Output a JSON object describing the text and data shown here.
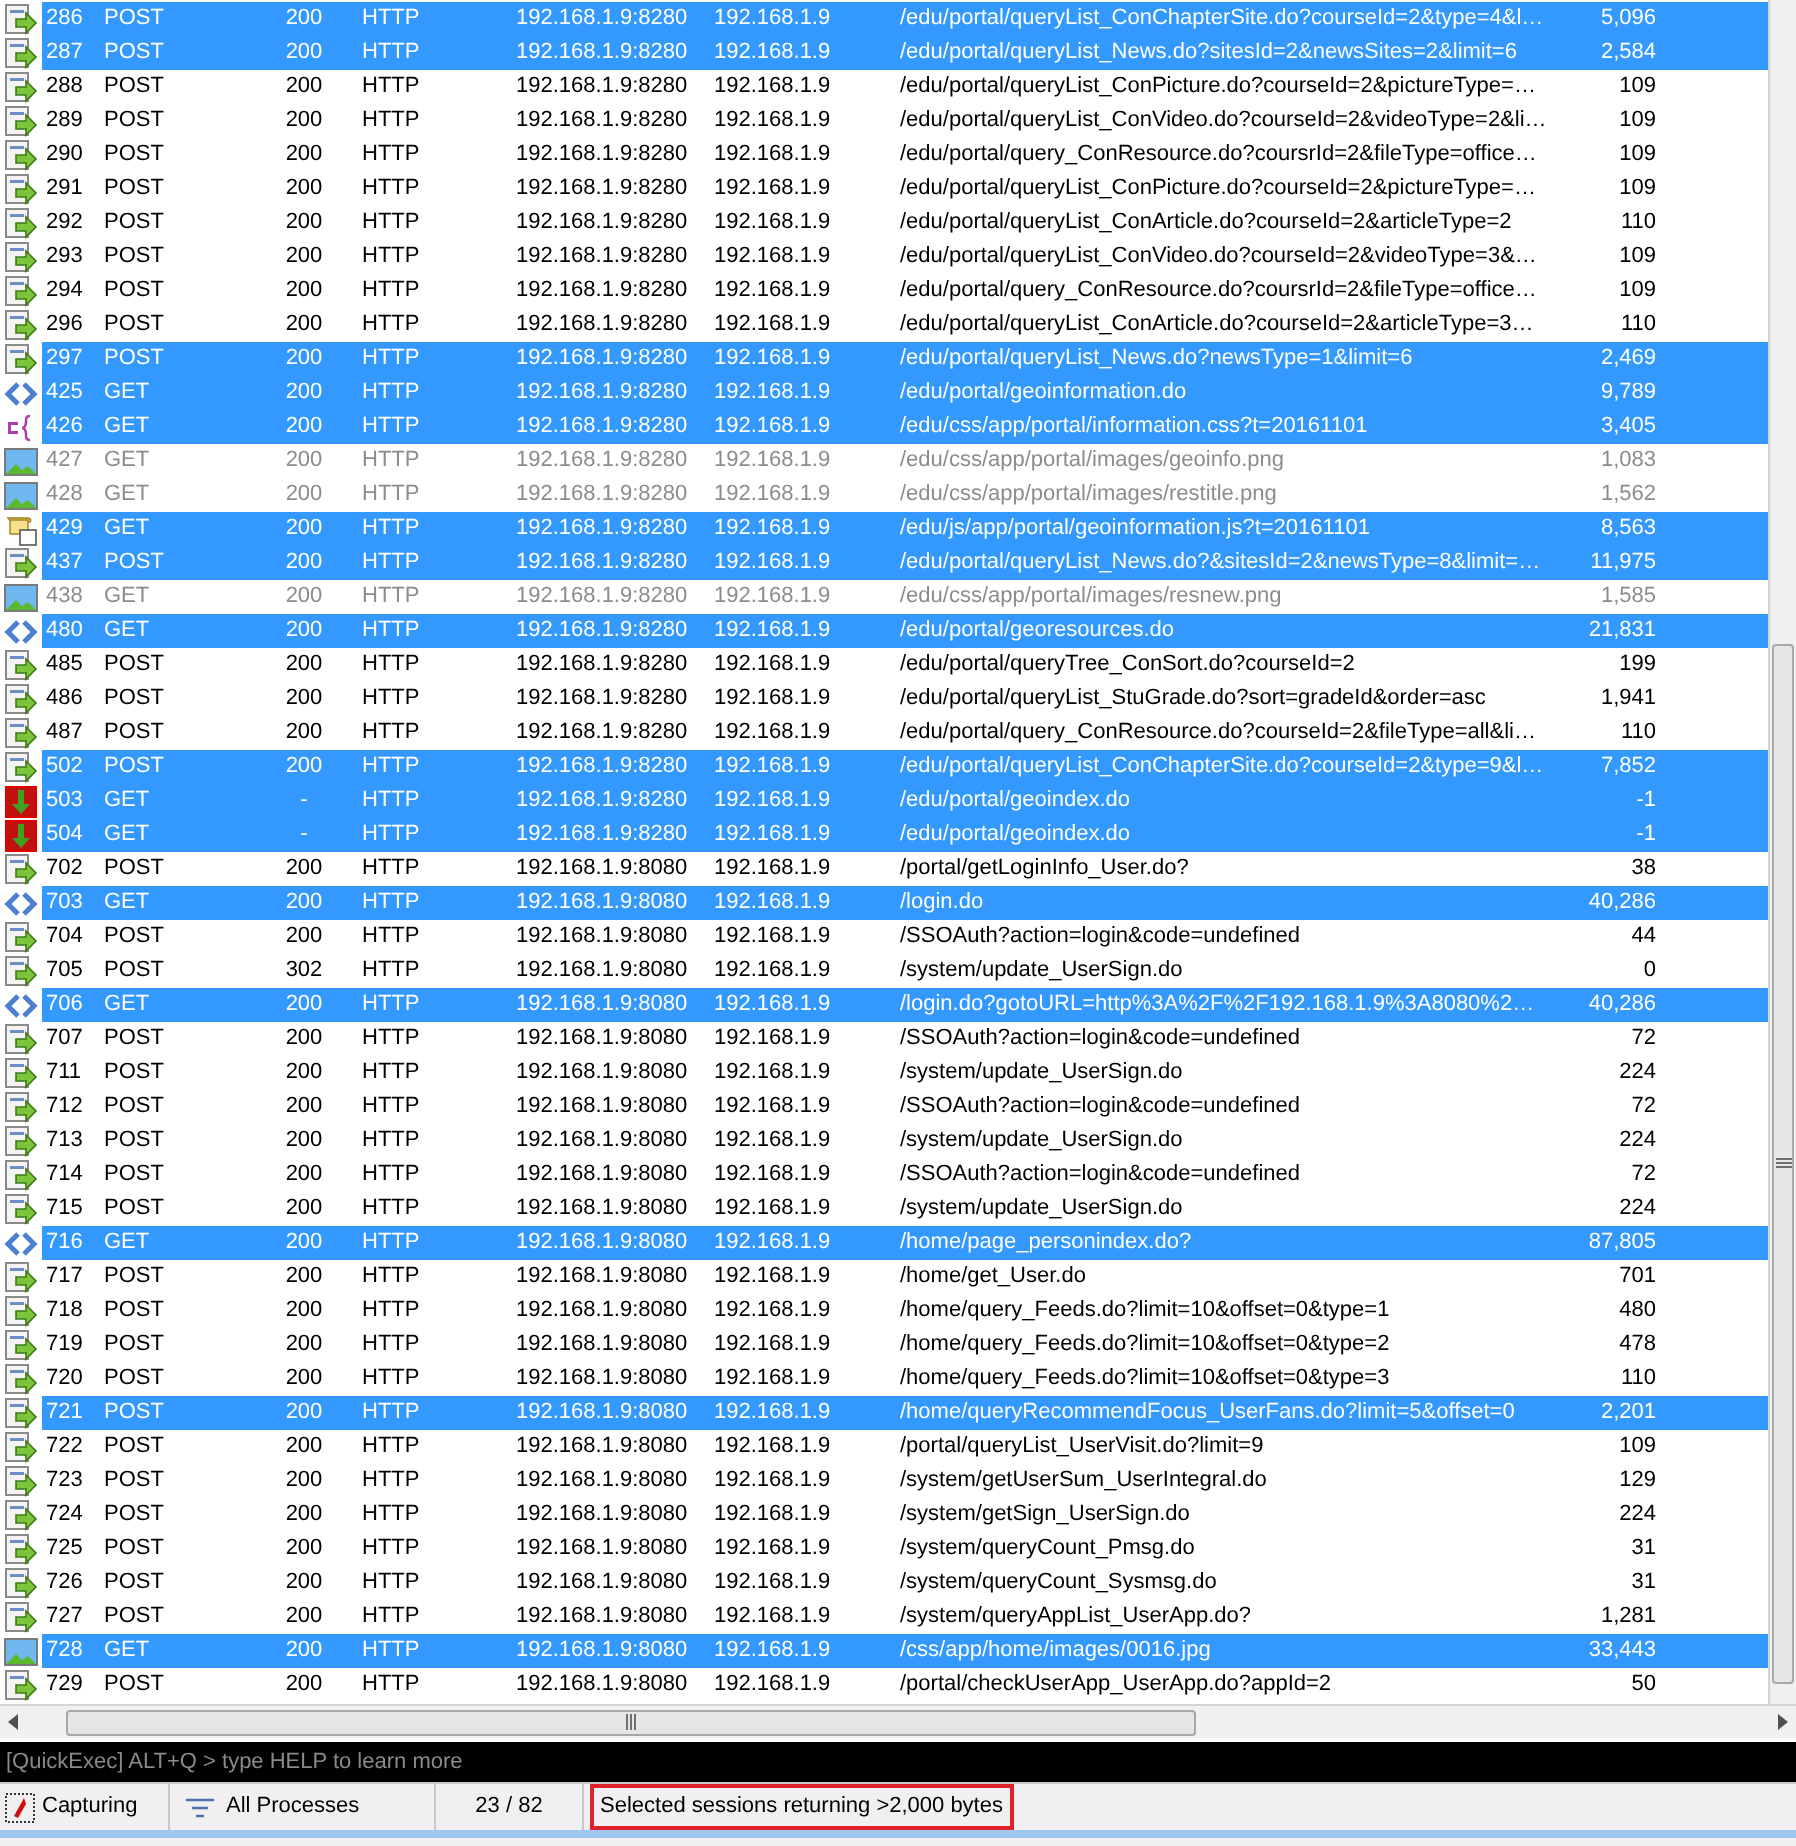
{
  "sessions": [
    {
      "kind": "post",
      "num": "286",
      "method": "POST",
      "result": "200",
      "protocol": "HTTP",
      "host": "192.168.1.9:8280",
      "server_ip": "192.168.1.9",
      "url": "/edu/portal/queryList_ConChapterSite.do?courseId=2&type=4&l…",
      "size": "5,096",
      "selected": true,
      "greyed": false
    },
    {
      "kind": "post",
      "num": "287",
      "method": "POST",
      "result": "200",
      "protocol": "HTTP",
      "host": "192.168.1.9:8280",
      "server_ip": "192.168.1.9",
      "url": "/edu/portal/queryList_News.do?sitesId=2&newsSites=2&limit=6",
      "size": "2,584",
      "selected": true,
      "greyed": false
    },
    {
      "kind": "post",
      "num": "288",
      "method": "POST",
      "result": "200",
      "protocol": "HTTP",
      "host": "192.168.1.9:8280",
      "server_ip": "192.168.1.9",
      "url": "/edu/portal/queryList_ConPicture.do?courseId=2&pictureType=…",
      "size": "109",
      "selected": false,
      "greyed": false
    },
    {
      "kind": "post",
      "num": "289",
      "method": "POST",
      "result": "200",
      "protocol": "HTTP",
      "host": "192.168.1.9:8280",
      "server_ip": "192.168.1.9",
      "url": "/edu/portal/queryList_ConVideo.do?courseId=2&videoType=2&li…",
      "size": "109",
      "selected": false,
      "greyed": false
    },
    {
      "kind": "post",
      "num": "290",
      "method": "POST",
      "result": "200",
      "protocol": "HTTP",
      "host": "192.168.1.9:8280",
      "server_ip": "192.168.1.9",
      "url": "/edu/portal/query_ConResource.do?coursrId=2&fileType=office…",
      "size": "109",
      "selected": false,
      "greyed": false
    },
    {
      "kind": "post",
      "num": "291",
      "method": "POST",
      "result": "200",
      "protocol": "HTTP",
      "host": "192.168.1.9:8280",
      "server_ip": "192.168.1.9",
      "url": "/edu/portal/queryList_ConPicture.do?courseId=2&pictureType=…",
      "size": "109",
      "selected": false,
      "greyed": false
    },
    {
      "kind": "post",
      "num": "292",
      "method": "POST",
      "result": "200",
      "protocol": "HTTP",
      "host": "192.168.1.9:8280",
      "server_ip": "192.168.1.9",
      "url": "/edu/portal/queryList_ConArticle.do?courseId=2&articleType=2",
      "size": "110",
      "selected": false,
      "greyed": false
    },
    {
      "kind": "post",
      "num": "293",
      "method": "POST",
      "result": "200",
      "protocol": "HTTP",
      "host": "192.168.1.9:8280",
      "server_ip": "192.168.1.9",
      "url": "/edu/portal/queryList_ConVideo.do?courseId=2&videoType=3&…",
      "size": "109",
      "selected": false,
      "greyed": false
    },
    {
      "kind": "post",
      "num": "294",
      "method": "POST",
      "result": "200",
      "protocol": "HTTP",
      "host": "192.168.1.9:8280",
      "server_ip": "192.168.1.9",
      "url": "/edu/portal/query_ConResource.do?coursrId=2&fileType=office…",
      "size": "109",
      "selected": false,
      "greyed": false
    },
    {
      "kind": "post",
      "num": "296",
      "method": "POST",
      "result": "200",
      "protocol": "HTTP",
      "host": "192.168.1.9:8280",
      "server_ip": "192.168.1.9",
      "url": "/edu/portal/queryList_ConArticle.do?courseId=2&articleType=3…",
      "size": "110",
      "selected": false,
      "greyed": false
    },
    {
      "kind": "post",
      "num": "297",
      "method": "POST",
      "result": "200",
      "protocol": "HTTP",
      "host": "192.168.1.9:8280",
      "server_ip": "192.168.1.9",
      "url": "/edu/portal/queryList_News.do?newsType=1&limit=6",
      "size": "2,469",
      "selected": true,
      "greyed": false
    },
    {
      "kind": "html",
      "num": "425",
      "method": "GET",
      "result": "200",
      "protocol": "HTTP",
      "host": "192.168.1.9:8280",
      "server_ip": "192.168.1.9",
      "url": "/edu/portal/geoinformation.do",
      "size": "9,789",
      "selected": true,
      "greyed": false
    },
    {
      "kind": "css",
      "num": "426",
      "method": "GET",
      "result": "200",
      "protocol": "HTTP",
      "host": "192.168.1.9:8280",
      "server_ip": "192.168.1.9",
      "url": "/edu/css/app/portal/information.css?t=20161101",
      "size": "3,405",
      "selected": true,
      "greyed": false
    },
    {
      "kind": "image",
      "num": "427",
      "method": "GET",
      "result": "200",
      "protocol": "HTTP",
      "host": "192.168.1.9:8280",
      "server_ip": "192.168.1.9",
      "url": "/edu/css/app/portal/images/geoinfo.png",
      "size": "1,083",
      "selected": false,
      "greyed": true
    },
    {
      "kind": "image",
      "num": "428",
      "method": "GET",
      "result": "200",
      "protocol": "HTTP",
      "host": "192.168.1.9:8280",
      "server_ip": "192.168.1.9",
      "url": "/edu/css/app/portal/images/restitle.png",
      "size": "1,562",
      "selected": false,
      "greyed": true
    },
    {
      "kind": "js",
      "num": "429",
      "method": "GET",
      "result": "200",
      "protocol": "HTTP",
      "host": "192.168.1.9:8280",
      "server_ip": "192.168.1.9",
      "url": "/edu/js/app/portal/geoinformation.js?t=20161101",
      "size": "8,563",
      "selected": true,
      "greyed": false
    },
    {
      "kind": "post",
      "num": "437",
      "method": "POST",
      "result": "200",
      "protocol": "HTTP",
      "host": "192.168.1.9:8280",
      "server_ip": "192.168.1.9",
      "url": "/edu/portal/queryList_News.do?&sitesId=2&newsType=8&limit=…",
      "size": "11,975",
      "selected": true,
      "greyed": false
    },
    {
      "kind": "image",
      "num": "438",
      "method": "GET",
      "result": "200",
      "protocol": "HTTP",
      "host": "192.168.1.9:8280",
      "server_ip": "192.168.1.9",
      "url": "/edu/css/app/portal/images/resnew.png",
      "size": "1,585",
      "selected": false,
      "greyed": true
    },
    {
      "kind": "html",
      "num": "480",
      "method": "GET",
      "result": "200",
      "protocol": "HTTP",
      "host": "192.168.1.9:8280",
      "server_ip": "192.168.1.9",
      "url": "/edu/portal/georesources.do",
      "size": "21,831",
      "selected": true,
      "greyed": false
    },
    {
      "kind": "post",
      "num": "485",
      "method": "POST",
      "result": "200",
      "protocol": "HTTP",
      "host": "192.168.1.9:8280",
      "server_ip": "192.168.1.9",
      "url": "/edu/portal/queryTree_ConSort.do?courseId=2",
      "size": "199",
      "selected": false,
      "greyed": false
    },
    {
      "kind": "post",
      "num": "486",
      "method": "POST",
      "result": "200",
      "protocol": "HTTP",
      "host": "192.168.1.9:8280",
      "server_ip": "192.168.1.9",
      "url": "/edu/portal/queryList_StuGrade.do?sort=gradeId&order=asc",
      "size": "1,941",
      "selected": false,
      "greyed": false
    },
    {
      "kind": "post",
      "num": "487",
      "method": "POST",
      "result": "200",
      "protocol": "HTTP",
      "host": "192.168.1.9:8280",
      "server_ip": "192.168.1.9",
      "url": "/edu/portal/query_ConResource.do?courseId=2&fileType=all&li…",
      "size": "110",
      "selected": false,
      "greyed": false
    },
    {
      "kind": "post",
      "num": "502",
      "method": "POST",
      "result": "200",
      "protocol": "HTTP",
      "host": "192.168.1.9:8280",
      "server_ip": "192.168.1.9",
      "url": "/edu/portal/queryList_ConChapterSite.do?courseId=2&type=9&l…",
      "size": "7,852",
      "selected": true,
      "greyed": false
    },
    {
      "kind": "error",
      "num": "503",
      "method": "GET",
      "result": "-",
      "protocol": "HTTP",
      "host": "192.168.1.9:8280",
      "server_ip": "192.168.1.9",
      "url": "/edu/portal/geoindex.do",
      "size": "-1",
      "selected": true,
      "greyed": false
    },
    {
      "kind": "error",
      "num": "504",
      "method": "GET",
      "result": "-",
      "protocol": "HTTP",
      "host": "192.168.1.9:8280",
      "server_ip": "192.168.1.9",
      "url": "/edu/portal/geoindex.do",
      "size": "-1",
      "selected": true,
      "greyed": false
    },
    {
      "kind": "post",
      "num": "702",
      "method": "POST",
      "result": "200",
      "protocol": "HTTP",
      "host": "192.168.1.9:8080",
      "server_ip": "192.168.1.9",
      "url": "/portal/getLoginInfo_User.do?",
      "size": "38",
      "selected": false,
      "greyed": false
    },
    {
      "kind": "html",
      "num": "703",
      "method": "GET",
      "result": "200",
      "protocol": "HTTP",
      "host": "192.168.1.9:8080",
      "server_ip": "192.168.1.9",
      "url": "/login.do",
      "size": "40,286",
      "selected": true,
      "greyed": false
    },
    {
      "kind": "post",
      "num": "704",
      "method": "POST",
      "result": "200",
      "protocol": "HTTP",
      "host": "192.168.1.9:8080",
      "server_ip": "192.168.1.9",
      "url": "/SSOAuth?action=login&code=undefined",
      "size": "44",
      "selected": false,
      "greyed": false
    },
    {
      "kind": "post",
      "num": "705",
      "method": "POST",
      "result": "302",
      "protocol": "HTTP",
      "host": "192.168.1.9:8080",
      "server_ip": "192.168.1.9",
      "url": "/system/update_UserSign.do",
      "size": "0",
      "selected": false,
      "greyed": false
    },
    {
      "kind": "html",
      "num": "706",
      "method": "GET",
      "result": "200",
      "protocol": "HTTP",
      "host": "192.168.1.9:8080",
      "server_ip": "192.168.1.9",
      "url": "/login.do?gotoURL=http%3A%2F%2F192.168.1.9%3A8080%2…",
      "size": "40,286",
      "selected": true,
      "greyed": false
    },
    {
      "kind": "post",
      "num": "707",
      "method": "POST",
      "result": "200",
      "protocol": "HTTP",
      "host": "192.168.1.9:8080",
      "server_ip": "192.168.1.9",
      "url": "/SSOAuth?action=login&code=undefined",
      "size": "72",
      "selected": false,
      "greyed": false
    },
    {
      "kind": "post",
      "num": "711",
      "method": "POST",
      "result": "200",
      "protocol": "HTTP",
      "host": "192.168.1.9:8080",
      "server_ip": "192.168.1.9",
      "url": "/system/update_UserSign.do",
      "size": "224",
      "selected": false,
      "greyed": false
    },
    {
      "kind": "post",
      "num": "712",
      "method": "POST",
      "result": "200",
      "protocol": "HTTP",
      "host": "192.168.1.9:8080",
      "server_ip": "192.168.1.9",
      "url": "/SSOAuth?action=login&code=undefined",
      "size": "72",
      "selected": false,
      "greyed": false
    },
    {
      "kind": "post",
      "num": "713",
      "method": "POST",
      "result": "200",
      "protocol": "HTTP",
      "host": "192.168.1.9:8080",
      "server_ip": "192.168.1.9",
      "url": "/system/update_UserSign.do",
      "size": "224",
      "selected": false,
      "greyed": false
    },
    {
      "kind": "post",
      "num": "714",
      "method": "POST",
      "result": "200",
      "protocol": "HTTP",
      "host": "192.168.1.9:8080",
      "server_ip": "192.168.1.9",
      "url": "/SSOAuth?action=login&code=undefined",
      "size": "72",
      "selected": false,
      "greyed": false
    },
    {
      "kind": "post",
      "num": "715",
      "method": "POST",
      "result": "200",
      "protocol": "HTTP",
      "host": "192.168.1.9:8080",
      "server_ip": "192.168.1.9",
      "url": "/system/update_UserSign.do",
      "size": "224",
      "selected": false,
      "greyed": false
    },
    {
      "kind": "html",
      "num": "716",
      "method": "GET",
      "result": "200",
      "protocol": "HTTP",
      "host": "192.168.1.9:8080",
      "server_ip": "192.168.1.9",
      "url": "/home/page_personindex.do?",
      "size": "87,805",
      "selected": true,
      "greyed": false
    },
    {
      "kind": "post",
      "num": "717",
      "method": "POST",
      "result": "200",
      "protocol": "HTTP",
      "host": "192.168.1.9:8080",
      "server_ip": "192.168.1.9",
      "url": "/home/get_User.do",
      "size": "701",
      "selected": false,
      "greyed": false
    },
    {
      "kind": "post",
      "num": "718",
      "method": "POST",
      "result": "200",
      "protocol": "HTTP",
      "host": "192.168.1.9:8080",
      "server_ip": "192.168.1.9",
      "url": "/home/query_Feeds.do?limit=10&offset=0&type=1",
      "size": "480",
      "selected": false,
      "greyed": false
    },
    {
      "kind": "post",
      "num": "719",
      "method": "POST",
      "result": "200",
      "protocol": "HTTP",
      "host": "192.168.1.9:8080",
      "server_ip": "192.168.1.9",
      "url": "/home/query_Feeds.do?limit=10&offset=0&type=2",
      "size": "478",
      "selected": false,
      "greyed": false
    },
    {
      "kind": "post",
      "num": "720",
      "method": "POST",
      "result": "200",
      "protocol": "HTTP",
      "host": "192.168.1.9:8080",
      "server_ip": "192.168.1.9",
      "url": "/home/query_Feeds.do?limit=10&offset=0&type=3",
      "size": "110",
      "selected": false,
      "greyed": false
    },
    {
      "kind": "post",
      "num": "721",
      "method": "POST",
      "result": "200",
      "protocol": "HTTP",
      "host": "192.168.1.9:8080",
      "server_ip": "192.168.1.9",
      "url": "/home/queryRecommendFocus_UserFans.do?limit=5&offset=0",
      "size": "2,201",
      "selected": true,
      "greyed": false
    },
    {
      "kind": "post",
      "num": "722",
      "method": "POST",
      "result": "200",
      "protocol": "HTTP",
      "host": "192.168.1.9:8080",
      "server_ip": "192.168.1.9",
      "url": "/portal/queryList_UserVisit.do?limit=9",
      "size": "109",
      "selected": false,
      "greyed": false
    },
    {
      "kind": "post",
      "num": "723",
      "method": "POST",
      "result": "200",
      "protocol": "HTTP",
      "host": "192.168.1.9:8080",
      "server_ip": "192.168.1.9",
      "url": "/system/getUserSum_UserIntegral.do",
      "size": "129",
      "selected": false,
      "greyed": false
    },
    {
      "kind": "post",
      "num": "724",
      "method": "POST",
      "result": "200",
      "protocol": "HTTP",
      "host": "192.168.1.9:8080",
      "server_ip": "192.168.1.9",
      "url": "/system/getSign_UserSign.do",
      "size": "224",
      "selected": false,
      "greyed": false
    },
    {
      "kind": "post",
      "num": "725",
      "method": "POST",
      "result": "200",
      "protocol": "HTTP",
      "host": "192.168.1.9:8080",
      "server_ip": "192.168.1.9",
      "url": "/system/queryCount_Pmsg.do",
      "size": "31",
      "selected": false,
      "greyed": false
    },
    {
      "kind": "post",
      "num": "726",
      "method": "POST",
      "result": "200",
      "protocol": "HTTP",
      "host": "192.168.1.9:8080",
      "server_ip": "192.168.1.9",
      "url": "/system/queryCount_Sysmsg.do",
      "size": "31",
      "selected": false,
      "greyed": false
    },
    {
      "kind": "post",
      "num": "727",
      "method": "POST",
      "result": "200",
      "protocol": "HTTP",
      "host": "192.168.1.9:8080",
      "server_ip": "192.168.1.9",
      "url": "/system/queryAppList_UserApp.do?",
      "size": "1,281",
      "selected": false,
      "greyed": false
    },
    {
      "kind": "image",
      "num": "728",
      "method": "GET",
      "result": "200",
      "protocol": "HTTP",
      "host": "192.168.1.9:8080",
      "server_ip": "192.168.1.9",
      "url": "/css/app/home/images/0016.jpg",
      "size": "33,443",
      "selected": true,
      "greyed": false
    },
    {
      "kind": "post",
      "num": "729",
      "method": "POST",
      "result": "200",
      "protocol": "HTTP",
      "host": "192.168.1.9:8080",
      "server_ip": "192.168.1.9",
      "url": "/portal/checkUserApp_UserApp.do?appId=2",
      "size": "50",
      "selected": false,
      "greyed": false
    }
  ],
  "quickexec": {
    "placeholder": "[QuickExec] ALT+Q > type HELP to learn more"
  },
  "status_bar": {
    "capture": "Capturing",
    "process_filter": "All Processes",
    "count": "23 / 82",
    "message": "Selected sessions returning >2,000 bytes"
  }
}
